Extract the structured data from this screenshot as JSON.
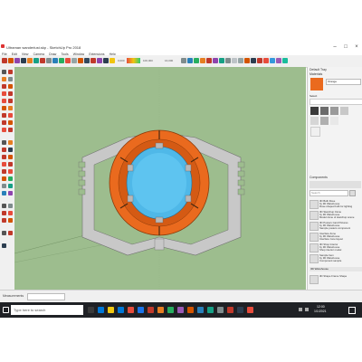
{
  "window": {
    "title": "Ultraman wanderlust.skp - SketchUp Pro 2018",
    "min_glyph": "–",
    "max_glyph": "□",
    "close_glyph": "×"
  },
  "menu": [
    "File",
    "Edit",
    "View",
    "Camera",
    "Draw",
    "Tools",
    "Window",
    "Extensions",
    "Help"
  ],
  "toolbar": {
    "scale_left": "0,000",
    "scale_mid": "100,000",
    "scale_right": "16,000"
  },
  "tray": {
    "materials_title": "Default Tray",
    "materials_label": "Materials",
    "current_material": "Orange",
    "select_tab": "Select",
    "components_label": "Components",
    "search_placeholder": "Search",
    "components": [
      {
        "title": "3D Bulb Rose",
        "sub": "by 3D Warehouse",
        "desc": "Rose shaped bulb for lighting"
      },
      {
        "title": "3D Sketchup Clone",
        "sub": "by 3D Warehouse",
        "desc": "Model clone of sketchup scene"
      },
      {
        "title": "3D Posters Card Pictures",
        "sub": "by 3D Warehouse",
        "desc": "Sample posters component"
      },
      {
        "title": "Interface Zone",
        "sub": "by 3D Warehouse",
        "desc": "Interface zone layout"
      },
      {
        "title": "3D Shop Interior",
        "sub": "by 3D Warehouse",
        "desc": "Shop interior model"
      },
      {
        "title": "Sample Item",
        "sub": "by 3D Warehouse",
        "desc": "Component sample"
      }
    ],
    "components_footer": "3D Warehouse",
    "bottom_item": "3D Shape Frame Shape"
  },
  "status": {
    "measurements_label": "Measurements"
  },
  "taskbar": {
    "search_placeholder": "Type here to search",
    "time": "12:00",
    "date": "1/1/2021"
  },
  "colors": {
    "viewport_bg": "#9dbd8e",
    "orange": "#ea6a1e",
    "blue": "#4fb8e8",
    "gray_frame": "#c8c8c8"
  }
}
